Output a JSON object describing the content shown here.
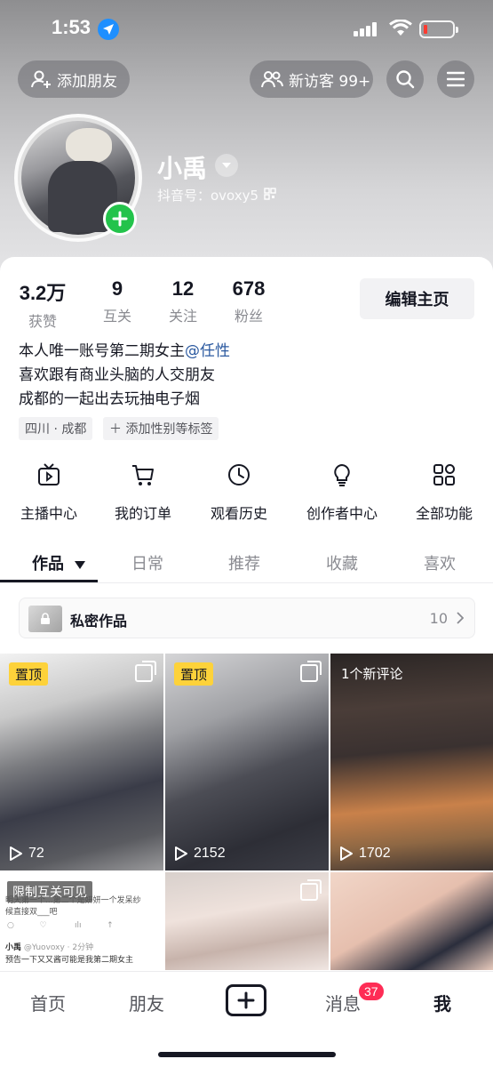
{
  "status_bar": {
    "time": "1:53"
  },
  "top_bar": {
    "add_friend_label": "添加朋友",
    "visitors_label": "新访客 99+"
  },
  "profile": {
    "username": "小禹",
    "douyin_id": "抖音号：ovoxy5"
  },
  "stats": [
    {
      "value": "3.2万",
      "label": "获赞"
    },
    {
      "value": "9",
      "label": "互关"
    },
    {
      "value": "12",
      "label": "关注"
    },
    {
      "value": "678",
      "label": "粉丝"
    }
  ],
  "edit_profile_label": "编辑主页",
  "bio": {
    "line1": "本人唯一账号第二期女主",
    "mention": "@任性",
    "line2": "喜欢跟有商业头脑的人交朋友",
    "line3": "成都的一起出去玩抽电子烟"
  },
  "tags": {
    "location": "四川 · 成都",
    "add_tag": "＋ 添加性别等标签"
  },
  "tools": [
    {
      "label": "主播中心",
      "icon": "tv-icon"
    },
    {
      "label": "我的订单",
      "icon": "cart-icon"
    },
    {
      "label": "观看历史",
      "icon": "clock-icon"
    },
    {
      "label": "创作者中心",
      "icon": "lightbulb-icon"
    },
    {
      "label": "全部功能",
      "icon": "grid-icon"
    }
  ],
  "tabs": [
    {
      "label": "作品"
    },
    {
      "label": "日常"
    },
    {
      "label": "推荐"
    },
    {
      "label": "收藏"
    },
    {
      "label": "喜欢"
    }
  ],
  "private_works": {
    "label": "私密作品",
    "count": "10"
  },
  "videos": [
    {
      "badge": "置顶",
      "plays": "72"
    },
    {
      "badge": "置顶",
      "plays": "2152"
    },
    {
      "badge": "1个新评论",
      "plays": "1702"
    },
    {
      "badge": "限制互关可见",
      "text_line1": "明天第一个...第二个是妍妍一个发呆纱",
      "text_line2": "候直接双___吧",
      "author": "小禹",
      "handle": "@Yuovoxy · 2分钟",
      "post_text": "预告一下又又酱可能是我第二期女主"
    },
    {
      "badge": ""
    },
    {
      "badge": ""
    }
  ],
  "bottom_nav": {
    "home": "首页",
    "friends": "朋友",
    "messages": "消息",
    "messages_badge": "37",
    "me": "我"
  },
  "colors": {
    "accent_red": "#fe2c55",
    "pin_yellow": "#fdd23a",
    "plus_green": "#23c34b",
    "mention_blue": "#2c5aa0"
  }
}
